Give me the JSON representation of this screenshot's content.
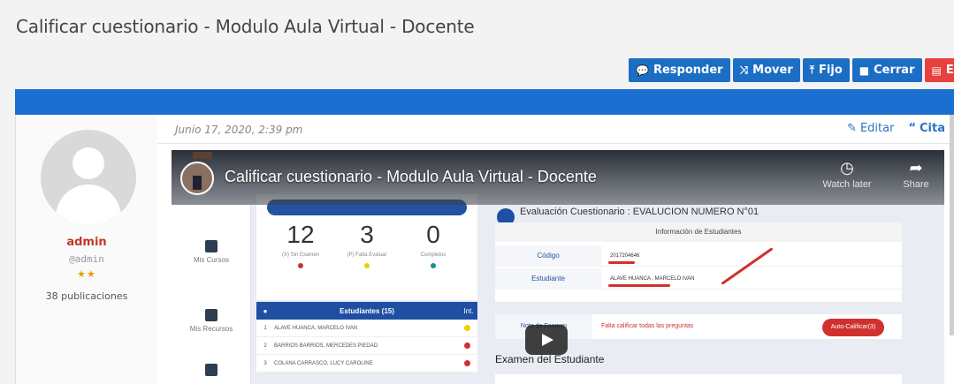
{
  "topic": {
    "title": "Calificar cuestionario - Modulo Aula Virtual - Docente"
  },
  "toolbar": {
    "responder": "Responder",
    "mover": "Mover",
    "fijo": "Fijo",
    "cerrar": "Cerrar",
    "eliminar": "Elimin"
  },
  "author": {
    "name": "admin",
    "handle": "@admin",
    "stars": "★★",
    "posts": "38 publicaciones"
  },
  "post": {
    "date": "Junio 17, 2020, 2:39 pm",
    "edit": "Editar",
    "quote": "Cita"
  },
  "video": {
    "title": "Calificar cuestionario - Modulo Aula Virtual - Docente",
    "watch_later": "Watch later",
    "share": "Share",
    "sidebar": [
      "Mis Cursos",
      "Mis Recursos"
    ],
    "stats": [
      {
        "value": "12",
        "label": "(X) Sin Examen",
        "color": "#d0312d"
      },
      {
        "value": "3",
        "label": "(P) Falta Evaluar",
        "color": "#f0d000"
      },
      {
        "value": "0",
        "label": "Completos",
        "color": "#1a8f8f"
      }
    ],
    "students_header": "Estudiantes (15)",
    "students_int": "Int.",
    "students": [
      {
        "n": "1",
        "name": "ALAVE HUANCA, MARCELO IVAN",
        "color": "#f0d000"
      },
      {
        "n": "2",
        "name": "BARRIOS BARRIOS, MERCEDES PIEDAD",
        "color": "#d0312d"
      },
      {
        "n": "3",
        "name": "COLANA CARRASCO, LUCY CAROLINE",
        "color": "#d0312d"
      }
    ],
    "eval_title": "Evaluación Cuestionario : EVALUCION NUMERO N°01",
    "info_header": "Información de Estudiantes",
    "codigo_label": "Código",
    "codigo_value": "2017204646",
    "estudiante_label": "Estudiante",
    "estudiante_value": "ALAVE HUANCA , MARCELO IVAN",
    "nota_label": "Nota de Examen",
    "nota_value": "Falta calificar todas las preguntas",
    "auto_button": "Auto-Calificar(3)",
    "examen_title": "Examen del Estudiante"
  },
  "colors": {
    "primary": "#1c6ec4",
    "danger": "#e8403e",
    "author": "#c0392b"
  }
}
